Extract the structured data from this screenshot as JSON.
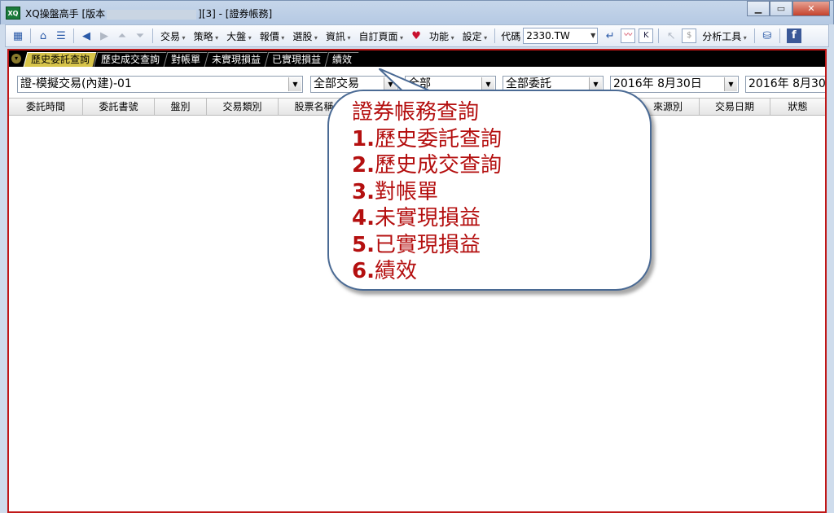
{
  "window": {
    "title_prefix": "XQ操盤高手 [版本",
    "title_suffix": "][3] - [證券帳務]",
    "app_icon": "XQ",
    "buttons": [
      "minimize",
      "maximize",
      "close"
    ]
  },
  "toolbar": {
    "menus": [
      "交易",
      "策略",
      "大盤",
      "報價",
      "選股",
      "資訊",
      "自訂頁面",
      "功能",
      "設定"
    ],
    "code_label": "代碼",
    "code_value": "2330.TW",
    "analysis_tools": "分析工具",
    "k_button": "K",
    "dollar_button": "$"
  },
  "tabs": [
    {
      "label": "歷史委託查詢",
      "active": true
    },
    {
      "label": "歷史成交查詢",
      "active": false
    },
    {
      "label": "對帳單",
      "active": false
    },
    {
      "label": "未實現損益",
      "active": false
    },
    {
      "label": "已實現損益",
      "active": false
    },
    {
      "label": "績效",
      "active": false
    }
  ],
  "filters": {
    "account": "證-模擬交易(內建)-01",
    "trade_type": "全部交易",
    "category": "全部",
    "order_type": "全部委託",
    "date_from": "2016年  8月30日",
    "date_to": "2016年  8月30"
  },
  "columns": [
    "委託時間",
    "委託書號",
    "盤別",
    "交易類別",
    "股票名稱",
    "",
    "",
    "",
    "",
    "來源別",
    "交易日期",
    "狀態"
  ],
  "callout": {
    "title": "證券帳務查詢",
    "items": [
      {
        "num": "1.",
        "text": "歷史委託查詢"
      },
      {
        "num": "2.",
        "text": "歷史成交查詢"
      },
      {
        "num": "3.",
        "text": "對帳單"
      },
      {
        "num": "4.",
        "text": "未實現損益"
      },
      {
        "num": "5.",
        "text": "已實現損益"
      },
      {
        "num": "6.",
        "text": "績效"
      }
    ]
  },
  "colors": {
    "active_tab": "#d7c44a",
    "frame_border": "#c01818",
    "callout_text": "#b40f0f",
    "callout_border": "#4a6a94"
  }
}
